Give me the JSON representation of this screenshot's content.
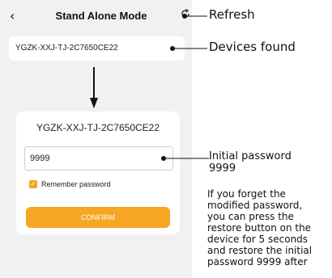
{
  "header": {
    "back_icon": "chevron-left-icon",
    "title": "Stand Alone Mode",
    "refresh_icon": "refresh-icon"
  },
  "device_list": {
    "items": [
      {
        "name": "YGZK-XXJ-TJ-2C7650CE22"
      }
    ]
  },
  "login": {
    "device_name": "YGZK-XXJ-TJ-2C7650CE22",
    "password_value": "9999",
    "remember_label": "Remember password",
    "remember_checked": true,
    "confirm_label": "CONFIRM"
  },
  "annotations": {
    "refresh": "Refresh",
    "devices_found": "Devices found",
    "initial_password_line1": "Initial password",
    "initial_password_line2": "9999",
    "note_lines": [
      "If you forget the",
      "modified password,",
      "you can press the",
      "restore button on the",
      "device for 5 seconds",
      "and restore the initial",
      "password 9999 after"
    ]
  },
  "colors": {
    "accent": "#f5a623",
    "background": "#f1f1f3"
  }
}
